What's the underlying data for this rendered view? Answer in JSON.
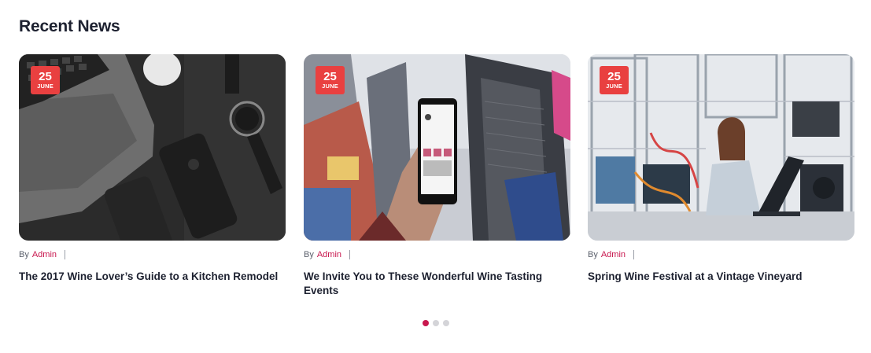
{
  "section": {
    "title": "Recent News"
  },
  "posts": [
    {
      "date_day": "25",
      "date_month": "JUNE",
      "by_label": "By",
      "author": "Admin",
      "title": "The 2017 Wine Lover’s Guide to a Kitchen Remodel",
      "image": "laptop-phones-watch-photo"
    },
    {
      "date_day": "25",
      "date_month": "JUNE",
      "by_label": "By",
      "author": "Admin",
      "title": "We Invite You to These Wonderful Wine Tasting Events",
      "image": "hand-holding-phone-city-photo"
    },
    {
      "date_day": "25",
      "date_month": "JUNE",
      "by_label": "By",
      "author": "Admin",
      "title": "Spring Wine Festival at a Vintage Vineyard",
      "image": "engineer-laptop-lab-photo"
    }
  ],
  "pagination": {
    "active_index": 0,
    "count": 3
  },
  "colors": {
    "accent": "#c8174e",
    "badge": "#e94040",
    "text": "#1d2130",
    "dot_inactive": "#d4d4d8"
  }
}
